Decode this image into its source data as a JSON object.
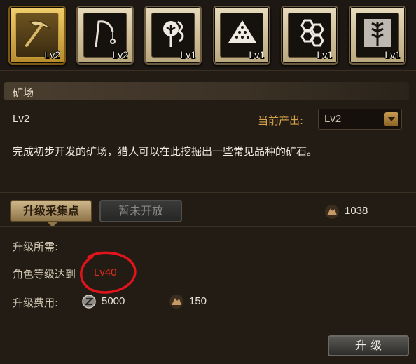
{
  "tabs": [
    {
      "icon": "pickaxe-icon",
      "level": "Lv2",
      "active": true
    },
    {
      "icon": "fishing-rod-icon",
      "level": "Lv2",
      "active": false
    },
    {
      "icon": "herb-tree-icon",
      "level": "Lv1",
      "active": false
    },
    {
      "icon": "ore-pile-icon",
      "level": "Lv1",
      "active": false
    },
    {
      "icon": "honeycomb-icon",
      "level": "Lv1",
      "active": false
    },
    {
      "icon": "wheat-icon",
      "level": "Lv1",
      "active": false
    }
  ],
  "section": {
    "title": "矿场",
    "level": "Lv2",
    "output_label": "当前产出:",
    "output_value": "Lv2",
    "description": "完成初步开发的矿场，猎人可以在此挖掘出一些常见品种的矿石。"
  },
  "actions": {
    "upgrade_point_label": "升级采集点",
    "not_open_label": "暂未开放",
    "resource_icon": "ore-resource-icon",
    "resource_amount": "1038"
  },
  "requirements": {
    "title": "升级所需:",
    "role_level_label": "角色等级达到",
    "role_level_value": "Lv40",
    "cost_label": "升级费用:",
    "coin_icon": "zenny-coin-icon",
    "coin_amount": "5000",
    "resource_icon": "ore-resource-icon",
    "resource_amount": "150"
  },
  "upgrade_button_label": "升级",
  "colors": {
    "accent_gold": "#d7a24c",
    "highlight_red": "#e12b1e",
    "background": "#221c15"
  }
}
